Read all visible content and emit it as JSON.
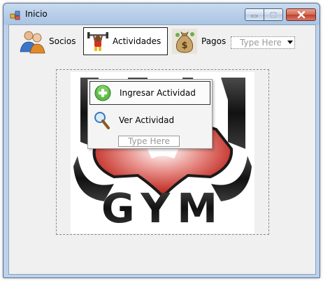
{
  "window": {
    "title": "Inicio"
  },
  "menu": {
    "items": [
      {
        "label": "Socios",
        "icon": "users-icon"
      },
      {
        "label": "Actividades",
        "icon": "weightlifter-icon"
      },
      {
        "label": "Pagos",
        "icon": "money-bag-icon"
      }
    ],
    "combo": {
      "placeholder": "Type Here"
    }
  },
  "dropdown": {
    "items": [
      {
        "label": "Ingresar Actividad",
        "icon": "add-icon"
      },
      {
        "label": "Ver Actividad",
        "icon": "magnifier-icon"
      }
    ],
    "input_placeholder": "Type Here"
  },
  "logo": {
    "text": "GYM"
  },
  "colors": {
    "accent_red": "#d0261e",
    "logo_dark": "#1a1a1a",
    "add_green": "#4cae3a"
  }
}
